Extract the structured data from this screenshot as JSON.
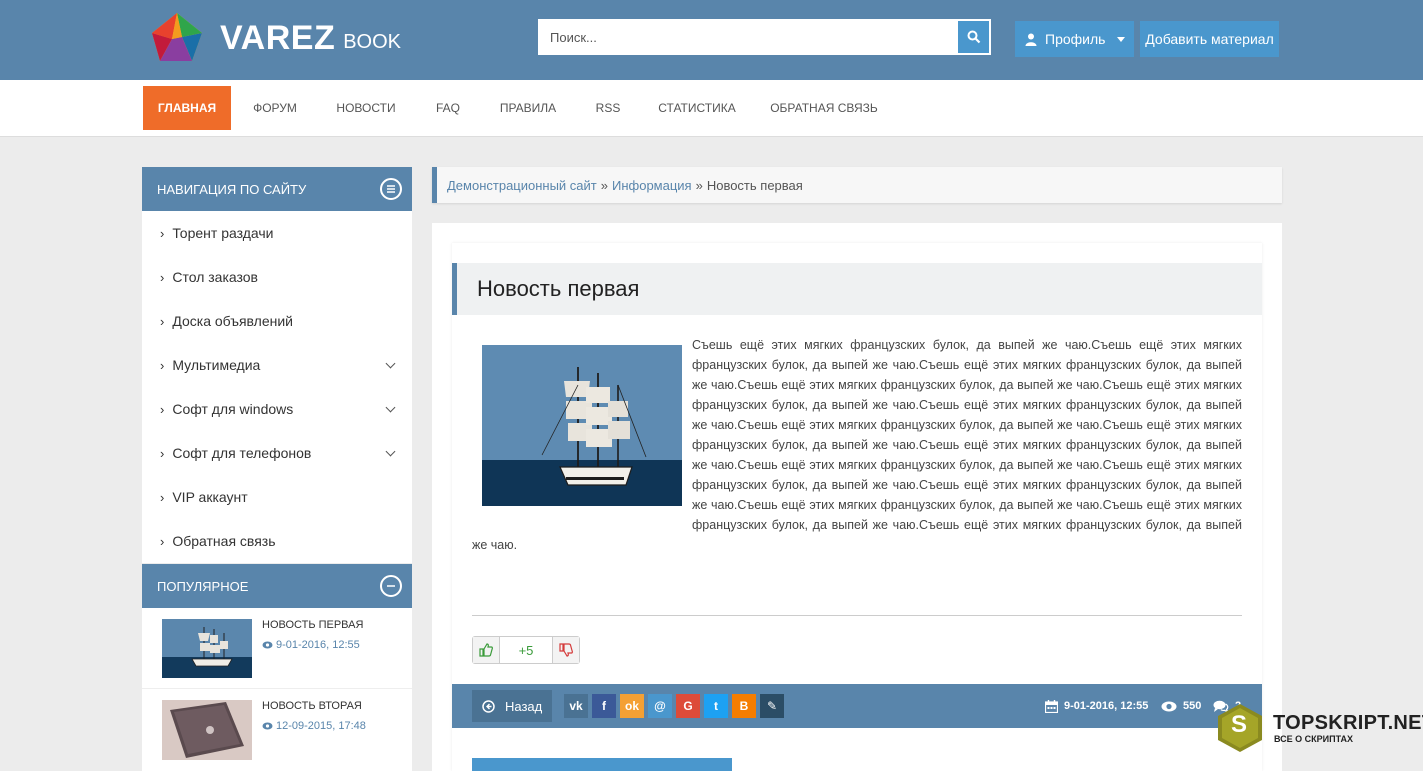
{
  "header": {
    "logo_text": "VAREZ",
    "logo_sub": "BOOK",
    "search_placeholder": "Поиск...",
    "profile_label": "Профиль",
    "add_label": "Добавить материал"
  },
  "nav": {
    "items": [
      "Главная",
      "Форум",
      "Новости",
      "FAQ",
      "Правила",
      "RSS",
      "Статистика",
      "Обратная связь"
    ]
  },
  "sidebar": {
    "nav_title": "Навигация по сайту",
    "items": [
      {
        "label": "Торент раздачи"
      },
      {
        "label": "Стол заказов"
      },
      {
        "label": "Доска объявлений"
      },
      {
        "label": "Мультимедиа"
      },
      {
        "label": "Софт для windows"
      },
      {
        "label": "Софт для телефонов"
      },
      {
        "label": "VIP аккаунт"
      },
      {
        "label": "Обратная связь"
      }
    ],
    "popular_title": "Популярное",
    "popular": [
      {
        "title": "Новость первая",
        "date": "9-01-2016, 12:55"
      },
      {
        "title": "Новость вторая",
        "date": "12-09-2015, 17:48"
      }
    ]
  },
  "breadcrumb": {
    "home": "Демонстрационный сайт",
    "section": "Информация",
    "current": "Новость первая",
    "sep": "»"
  },
  "article": {
    "title": "Новость первая",
    "body": "Съешь ещё этих мягких французских булок, да выпей же чаю.Съешь ещё этих мягких французских булок, да выпей же чаю.Съешь ещё этих мягких французских булок, да выпей же чаю.Съешь ещё этих мягких французских булок, да выпей же чаю.Съешь ещё этих мягких французских булок, да выпей же чаю.Съешь ещё этих мягких французских булок, да выпей же чаю.Съешь ещё этих мягких французских булок, да выпей же чаю.Съешь ещё этих мягких французских булок, да выпей же чаю.Съешь ещё этих мягких французских булок, да выпей же чаю.Съешь ещё этих мягких французских булок, да выпей же чаю.Съешь ещё этих мягких французских булок, да выпей же чаю.Съешь ещё этих мягких французских булок, да выпей же чаю.Съешь ещё этих мягких французских булок, да выпей же чаю.Съешь ещё этих мягких французских булок, да выпей же чаю.Съешь ещё этих мягких французских булок, да выпей же чаю.",
    "rating": "+5",
    "back_label": "Назад",
    "date": "9-01-2016, 12:55",
    "views": "550",
    "comments": "2"
  },
  "share": [
    {
      "icon": "vk-icon",
      "glyph": "vk",
      "color": "#4a7293"
    },
    {
      "icon": "facebook-icon",
      "glyph": "f",
      "color": "#3b5998"
    },
    {
      "icon": "odnoklassniki-icon",
      "glyph": "ok",
      "color": "#f4a034"
    },
    {
      "icon": "moimir-icon",
      "glyph": "@",
      "color": "#4a97cd"
    },
    {
      "icon": "google-icon",
      "glyph": "G",
      "color": "#dd4b39"
    },
    {
      "icon": "twitter-icon",
      "glyph": "t",
      "color": "#1da1f2"
    },
    {
      "icon": "blogger-icon",
      "glyph": "B",
      "color": "#f57d00"
    },
    {
      "icon": "livejournal-icon",
      "glyph": "✎",
      "color": "#2b4d66"
    }
  ],
  "watermark": {
    "text": "TOPSKRIPT.NET",
    "sub": "ВСЕ О СКРИПТАХ",
    "letter": "S"
  },
  "colors": {
    "primary": "#5985ab",
    "accent": "#ef6c29",
    "button": "#4a97cd"
  }
}
